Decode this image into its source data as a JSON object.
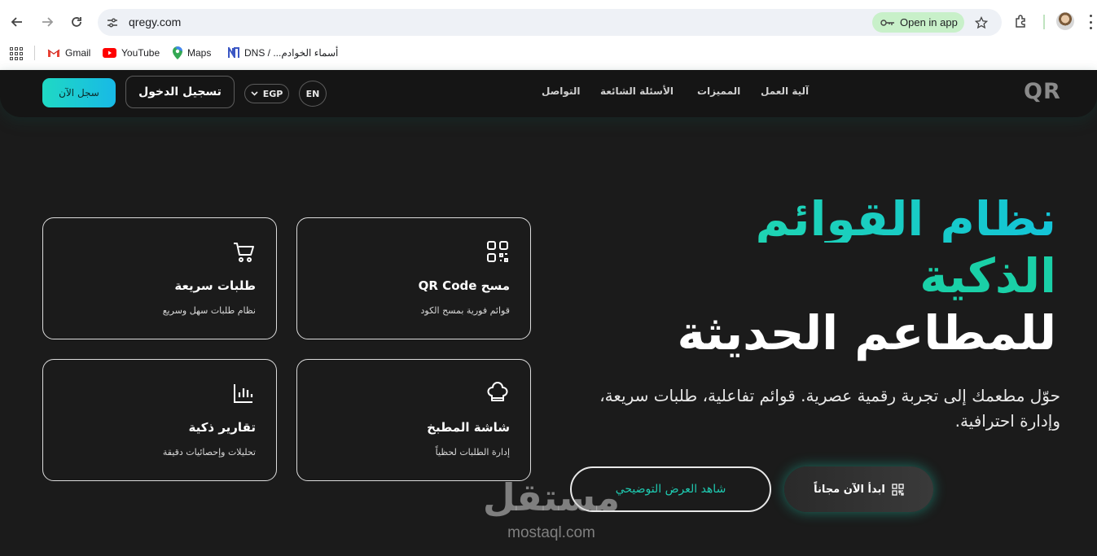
{
  "browser": {
    "url": "qregy.com",
    "open_in_app": "Open in app",
    "icons": {
      "back": "back-arrow-icon",
      "forward": "forward-arrow-icon",
      "reload": "reload-icon",
      "site_settings": "tune-icon",
      "bookmark_star": "star-icon",
      "extensions": "puzzle-icon",
      "menu": "more-vert-icon"
    },
    "bookmarks": [
      {
        "label": "Gmail",
        "icon": "gmail-icon"
      },
      {
        "label": "YouTube",
        "icon": "youtube-icon"
      },
      {
        "label": "Maps",
        "icon": "maps-pin-icon"
      },
      {
        "label": "أسماء الخوادم... / DNS",
        "icon": "dns-icon"
      }
    ]
  },
  "header": {
    "logo": "QR",
    "nav": [
      "آلية العمل",
      "المميزات",
      "الأسئلة الشائعة",
      "التواصل"
    ],
    "language": "EN",
    "currency": "EGP",
    "login_label": "تسجيل الدخول",
    "register_label": "سجل الآن"
  },
  "hero": {
    "line1": "نظام القوائم",
    "line2": "الذكية",
    "line3": "للمطاعم الحديثة",
    "subtitle": "حوّل مطعمك إلى تجربة رقمية عصرية. قوائم تفاعلية، طلبات سريعة، وإدارة احترافية.",
    "start_label": "ابدأ الآن مجاناً",
    "demo_label": "شاهد العرض التوضيحي"
  },
  "features": [
    {
      "title": "مسح QR Code",
      "desc": "قوائم فورية بمسح الكود",
      "icon": "qr-code-icon"
    },
    {
      "title": "طلبات سريعة",
      "desc": "نظام طلبات سهل وسريع",
      "icon": "shopping-cart-icon"
    },
    {
      "title": "شاشة المطبخ",
      "desc": "إدارة الطلبات لحظياً",
      "icon": "chef-hat-icon"
    },
    {
      "title": "تقارير ذكية",
      "desc": "تحليلات وإحصائيات دقيقة",
      "icon": "bar-chart-icon"
    }
  ],
  "watermark": {
    "arabic": "مستقل",
    "latin": "mostaql.com"
  },
  "colors": {
    "accent": "#1ed4b2",
    "accent_alt": "#18b9e6",
    "background": "#1b1b1b"
  }
}
